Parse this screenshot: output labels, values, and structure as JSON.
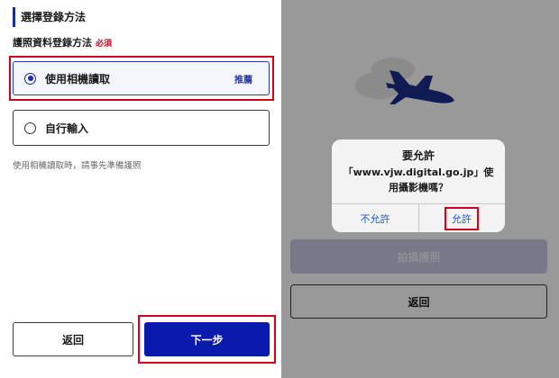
{
  "left": {
    "section_title": "選擇登錄方法",
    "subtitle": "護照資料登錄方法",
    "required": "必須",
    "options": [
      {
        "label": "使用相機讀取",
        "badge": "推薦",
        "selected": true
      },
      {
        "label": "自行輸入",
        "selected": false
      }
    ],
    "hint": "使用相機讀取時，請事先準備護照",
    "back_label": "返回",
    "next_label": "下一步"
  },
  "right": {
    "capture_label": "拍攝護照",
    "back_label": "返回",
    "dialog": {
      "title": "要允許",
      "message": "「www.vjw.digital.go.jp」使用攝影機嗎？",
      "deny_label": "不允許",
      "allow_label": "允許"
    }
  },
  "colors": {
    "accent": "#0a1aac",
    "highlight": "#d6001c",
    "required": "#d0021b",
    "ios_blue": "#1a57d6",
    "plane": "#1c2e8a"
  }
}
